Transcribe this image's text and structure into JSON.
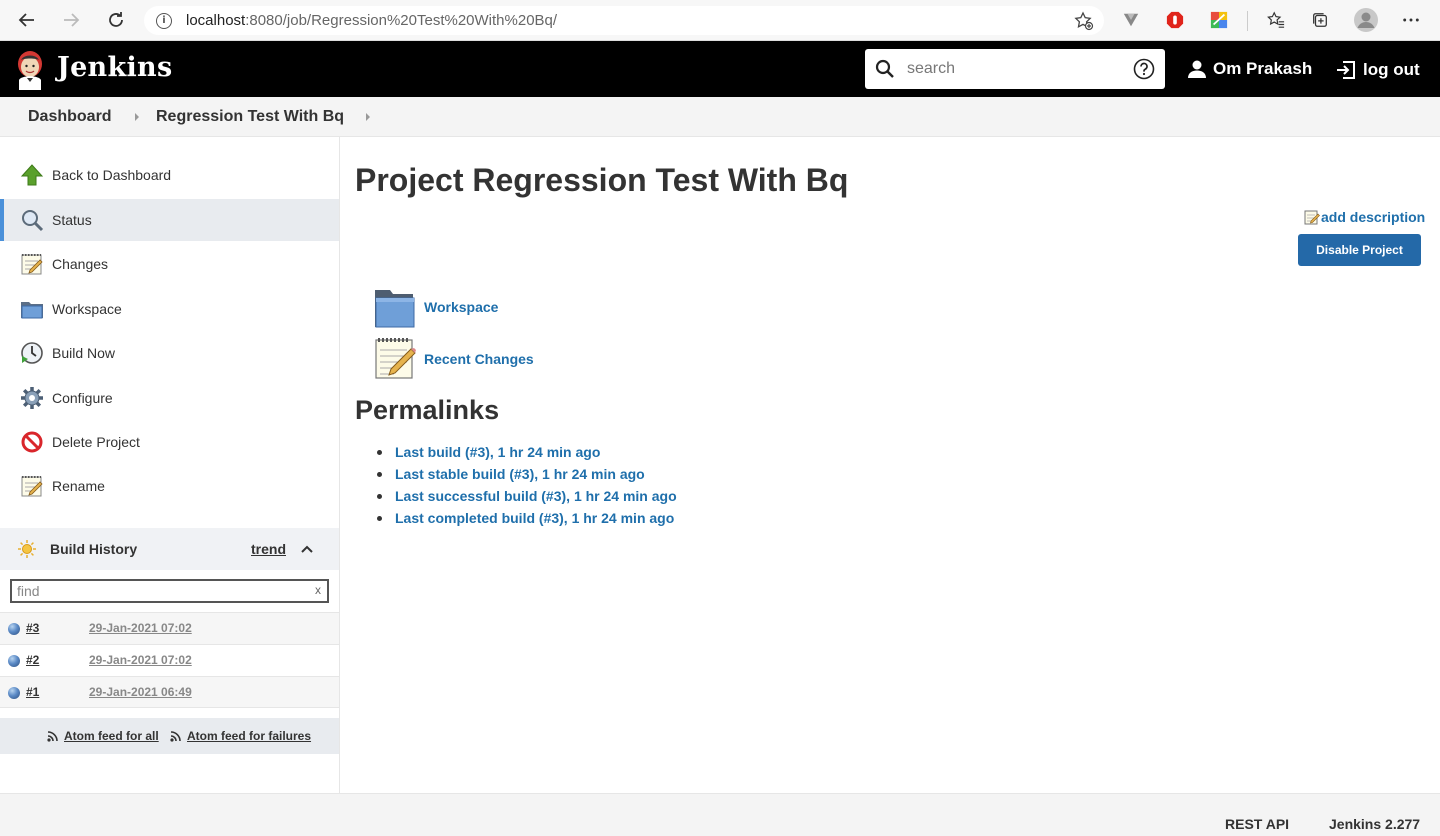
{
  "browser": {
    "url_host": "localhost",
    "url_path": ":8080/job/Regression%20Test%20With%20Bq/"
  },
  "header": {
    "brand": "Jenkins",
    "search_placeholder": "search",
    "user_name": "Om Prakash",
    "logout_label": "log out"
  },
  "breadcrumb": {
    "items": [
      "Dashboard",
      "Regression Test With Bq"
    ]
  },
  "sidebar": {
    "tasks": [
      {
        "label": "Back to Dashboard",
        "icon": "up-arrow-icon"
      },
      {
        "label": "Status",
        "icon": "magnifier-icon"
      },
      {
        "label": "Changes",
        "icon": "notepad-icon"
      },
      {
        "label": "Workspace",
        "icon": "folder-icon"
      },
      {
        "label": "Build Now",
        "icon": "clock-icon"
      },
      {
        "label": "Configure",
        "icon": "gear-icon"
      },
      {
        "label": "Delete Project",
        "icon": "no-entry-icon"
      },
      {
        "label": "Rename",
        "icon": "notepad-icon"
      }
    ],
    "build_history": {
      "title": "Build History",
      "trend_label": "trend",
      "find_placeholder": "find",
      "clear_label": "x",
      "builds": [
        {
          "number": "#3",
          "date": "29-Jan-2021 07:02"
        },
        {
          "number": "#2",
          "date": "29-Jan-2021 07:02"
        },
        {
          "number": "#1",
          "date": "29-Jan-2021 06:49"
        }
      ],
      "feed_all": "Atom feed for all",
      "feed_failures": "Atom feed for failures"
    }
  },
  "main": {
    "title": "Project Regression Test With Bq",
    "add_description": "add description",
    "disable_button": "Disable Project",
    "links": [
      {
        "label": "Workspace",
        "icon": "folder-icon"
      },
      {
        "label": "Recent Changes",
        "icon": "notepad-icon"
      }
    ],
    "permalinks_title": "Permalinks",
    "permalinks": [
      "Last build (#3), 1 hr 24 min ago",
      "Last stable build (#3), 1 hr 24 min ago",
      "Last successful build (#3), 1 hr 24 min ago",
      "Last completed build (#3), 1 hr 24 min ago"
    ]
  },
  "footer": {
    "rest_api": "REST API",
    "version": "Jenkins 2.277"
  },
  "colors": {
    "link": "#1f6fab",
    "button": "#2469a8",
    "header_bg": "#000000"
  }
}
